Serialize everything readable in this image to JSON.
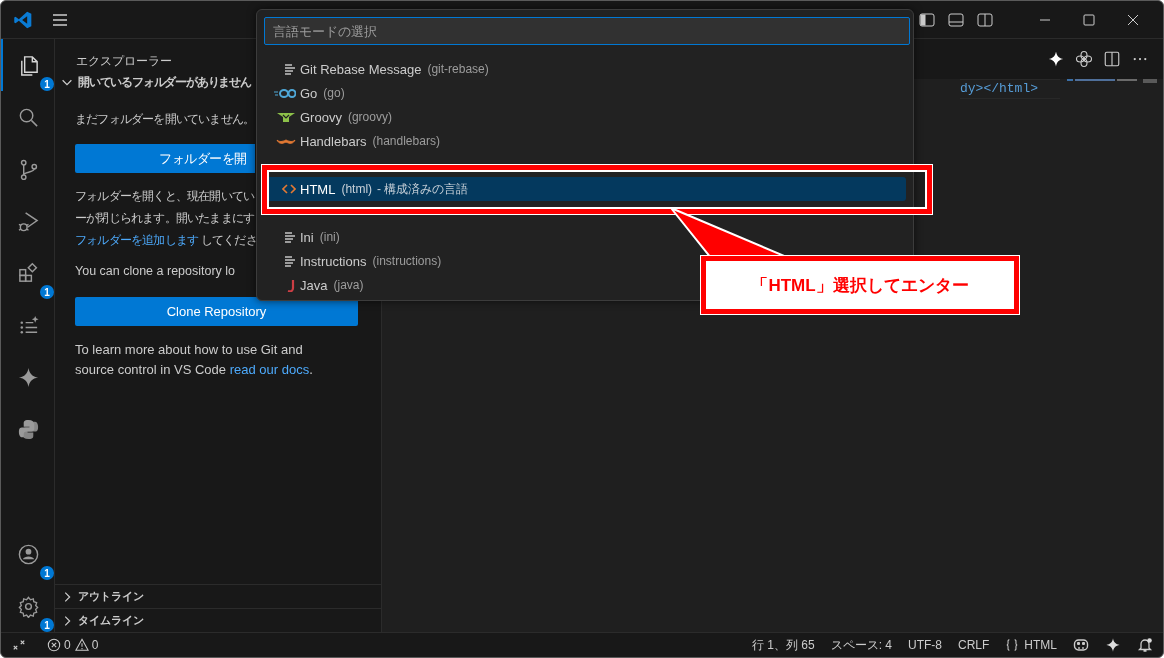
{
  "activity_bar": {
    "items": [
      {
        "kind": "explorer",
        "selected": true,
        "badge": "1"
      },
      {
        "kind": "search",
        "selected": false
      },
      {
        "kind": "source-control",
        "selected": false
      },
      {
        "kind": "run-debug",
        "selected": false
      },
      {
        "kind": "extensions",
        "selected": false,
        "badge": "1"
      },
      {
        "kind": "checklist",
        "selected": false
      },
      {
        "kind": "sparkle",
        "selected": false
      },
      {
        "kind": "python",
        "selected": false
      }
    ],
    "bottom_items": [
      {
        "kind": "account",
        "badge": "1"
      },
      {
        "kind": "settings",
        "badge": "1"
      }
    ]
  },
  "sidebar": {
    "title": "エクスプローラー",
    "section": {
      "label": "開いているフォルダーがありません",
      "expanded": true
    },
    "message": "まだフォルダーを開いていません。",
    "open_folder_button": "フォルダーを開",
    "info_lines": [
      "フォルダーを開くと、現在開いてい",
      "ーが閉じられます。開いたままにす"
    ],
    "info_link": "フォルダーを追加します",
    "info_tail": "してくださ",
    "clone_text": "You can clone a repository lo",
    "clone_button": "Clone Repository",
    "git_text": "To learn more about how to use Git and source control in VS Code ",
    "git_link": "read our docs",
    "git_tail": ".",
    "collapsed_sections": [
      {
        "label": "アウトライン",
        "expanded": false
      },
      {
        "label": "タイムライン",
        "expanded": false
      }
    ]
  },
  "editor": {
    "code_line": "dy></html>"
  },
  "quick_pick": {
    "placeholder": "言語モードの選択",
    "items": [
      {
        "label": "Git Rebase Message",
        "language_id": "(git-rebase)",
        "kind": "lines",
        "selected": false
      },
      {
        "label": "Go",
        "language_id": "(go)",
        "kind": "go",
        "selected": false
      },
      {
        "label": "Groovy",
        "language_id": "(groovy)",
        "kind": "groovy",
        "selected": false
      },
      {
        "label": "Handlebars",
        "language_id": "(handlebars)",
        "kind": "handlebars",
        "selected": false
      },
      {
        "label": "HTML",
        "language_id": "(html)",
        "description": "- 構成済みの言語",
        "kind": "html",
        "selected": true
      },
      {
        "label": "Ini",
        "language_id": "(ini)",
        "kind": "lines",
        "selected": false
      },
      {
        "label": "Instructions",
        "language_id": "(instructions)",
        "kind": "lines",
        "selected": false
      },
      {
        "label": "Java",
        "language_id": "(java)",
        "kind": "java",
        "selected": false
      }
    ]
  },
  "annotation": {
    "text": "「HTML」選択してエンター"
  },
  "status_bar": {
    "errors": "0",
    "warnings": "0",
    "items": [
      "行 1、列 65",
      "スペース: 4",
      "UTF-8",
      "CRLF"
    ],
    "language": "HTML"
  }
}
